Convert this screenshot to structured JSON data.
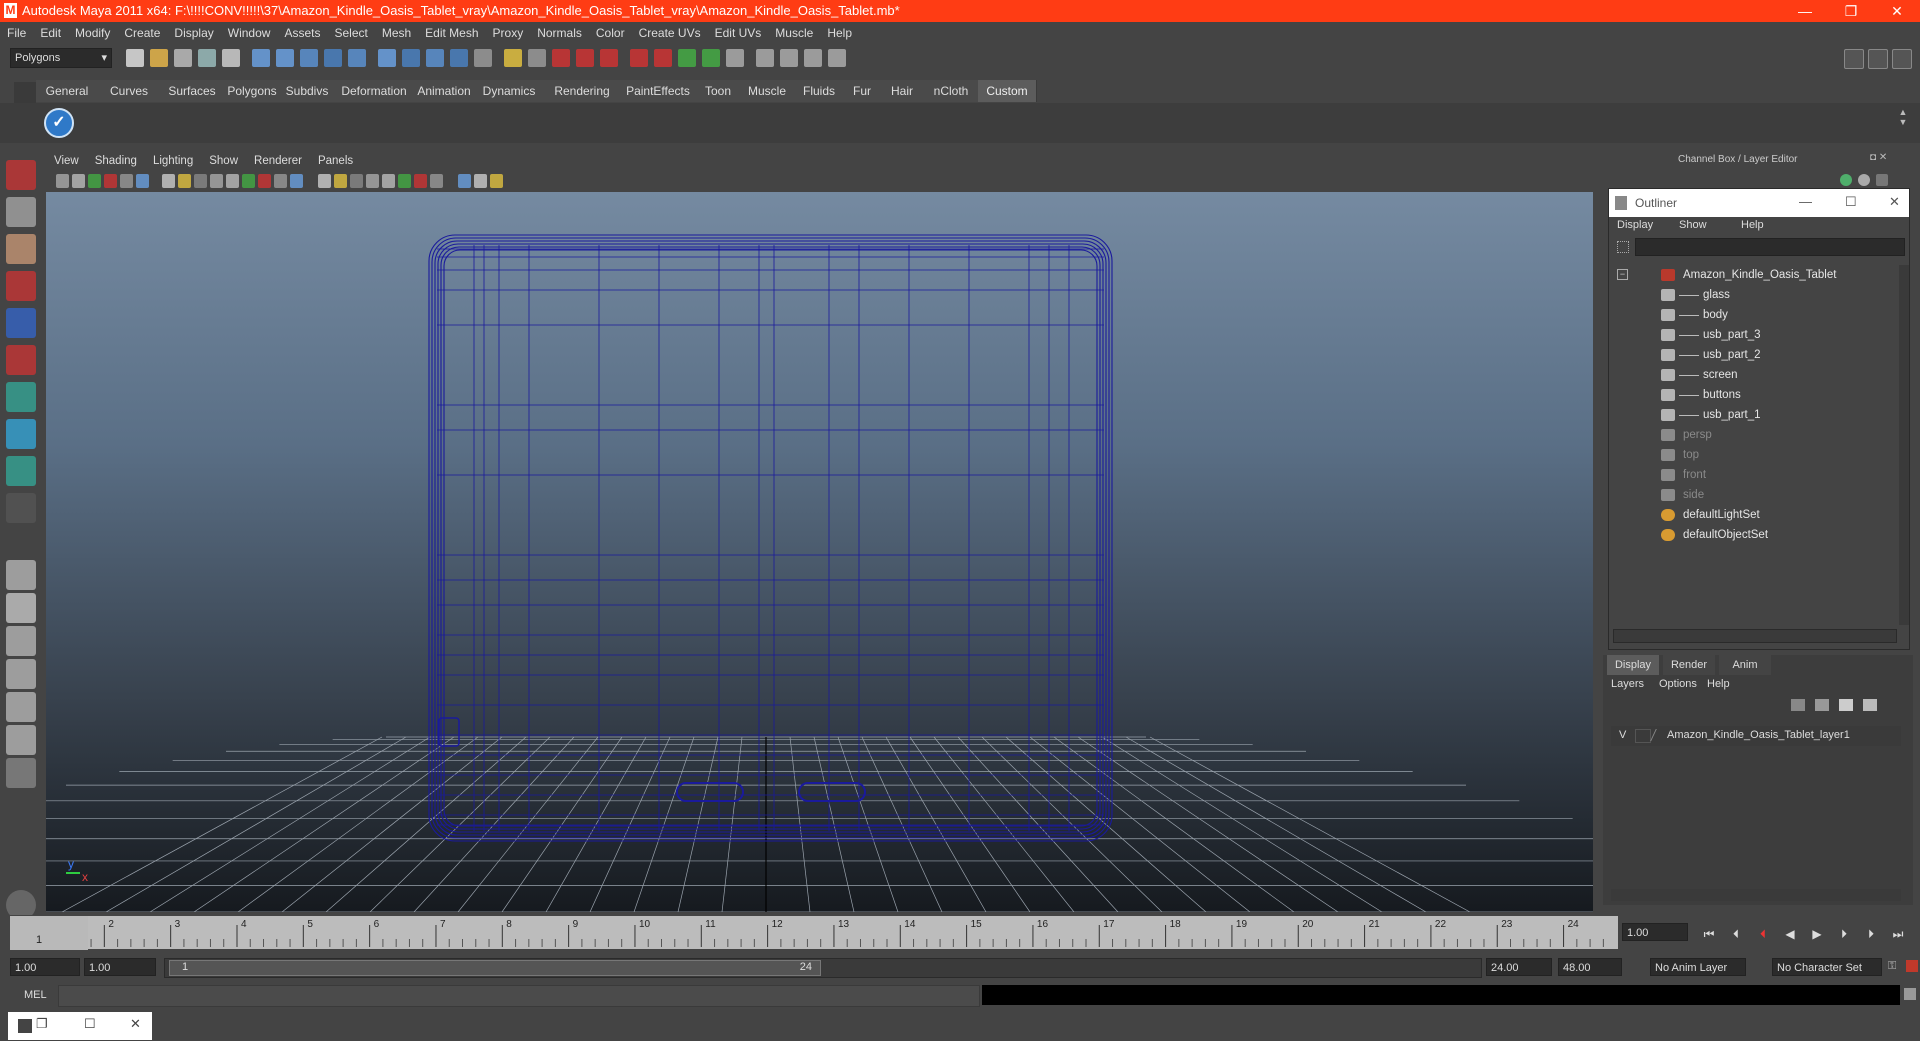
{
  "window": {
    "title": "Autodesk Maya 2011 x64: F:\\!!!!CONV!!!!!\\37\\Amazon_Kindle_Oasis_Tablet_vray\\Amazon_Kindle_Oasis_Tablet_vray\\Amazon_Kindle_Oasis_Tablet.mb*",
    "app_icon": "M",
    "minimize": "—",
    "restore": "❐",
    "close": "✕"
  },
  "menubar": [
    "File",
    "Edit",
    "Modify",
    "Create",
    "Display",
    "Window",
    "Assets",
    "Select",
    "Mesh",
    "Edit Mesh",
    "Proxy",
    "Normals",
    "Color",
    "Create UVs",
    "Edit UVs",
    "Muscle",
    "Help"
  ],
  "statusline": {
    "mode": "Polygons"
  },
  "shelf_tabs": [
    "General",
    "Curves",
    "Surfaces",
    "Polygons",
    "Subdivs",
    "Deformation",
    "Animation",
    "Dynamics",
    "Rendering",
    "PaintEffects",
    "Toon",
    "Muscle",
    "Fluids",
    "Fur",
    "Hair",
    "nCloth",
    "Custom"
  ],
  "shelf_active_tab": "Custom",
  "viewport": {
    "menu": [
      "View",
      "Shading",
      "Lighting",
      "Show",
      "Renderer",
      "Panels"
    ],
    "axis_y": "y",
    "axis_x": "x"
  },
  "channel_box": {
    "title": "Channel Box / Layer Editor"
  },
  "outliner": {
    "title": "Outliner",
    "menu": [
      "Display",
      "Show",
      "Help"
    ],
    "items": [
      {
        "label": "Amazon_Kindle_Oasis_Tablet",
        "level": 0,
        "dim": false,
        "kind": "group"
      },
      {
        "label": "glass",
        "level": 1,
        "dim": false,
        "kind": "mesh"
      },
      {
        "label": "body",
        "level": 1,
        "dim": false,
        "kind": "mesh"
      },
      {
        "label": "usb_part_3",
        "level": 1,
        "dim": false,
        "kind": "mesh"
      },
      {
        "label": "usb_part_2",
        "level": 1,
        "dim": false,
        "kind": "mesh"
      },
      {
        "label": "screen",
        "level": 1,
        "dim": false,
        "kind": "mesh"
      },
      {
        "label": "buttons",
        "level": 1,
        "dim": false,
        "kind": "mesh"
      },
      {
        "label": "usb_part_1",
        "level": 1,
        "dim": false,
        "kind": "mesh"
      },
      {
        "label": "persp",
        "level": 0,
        "dim": true,
        "kind": "camera"
      },
      {
        "label": "top",
        "level": 0,
        "dim": true,
        "kind": "camera"
      },
      {
        "label": "front",
        "level": 0,
        "dim": true,
        "kind": "camera"
      },
      {
        "label": "side",
        "level": 0,
        "dim": true,
        "kind": "camera"
      },
      {
        "label": "defaultLightSet",
        "level": 0,
        "dim": false,
        "kind": "set"
      },
      {
        "label": "defaultObjectSet",
        "level": 0,
        "dim": false,
        "kind": "set"
      }
    ]
  },
  "layer_editor": {
    "tabs": [
      "Display",
      "Render",
      "Anim"
    ],
    "active_tab": "Display",
    "menu": [
      "Layers",
      "Options",
      "Help"
    ],
    "layer": {
      "visible": "V",
      "name": "Amazon_Kindle_Oasis_Tablet_layer1"
    }
  },
  "timeline": {
    "ticks": [
      "1",
      "2",
      "3",
      "4",
      "5",
      "6",
      "7",
      "8",
      "9",
      "10",
      "11",
      "12",
      "13",
      "14",
      "15",
      "16",
      "17",
      "18",
      "19",
      "20",
      "21",
      "22",
      "23",
      "24"
    ],
    "current_frame_marker": "1",
    "current_time": "1.00"
  },
  "range": {
    "start": "1.00",
    "playback_start": "1.00",
    "slider_start": "1",
    "slider_end": "24",
    "playback_end": "24.00",
    "end": "48.00",
    "anim_layer": "No Anim Layer",
    "character_set": "No Character Set"
  },
  "cmdline": {
    "label": "MEL"
  },
  "colors": {
    "titlebar": "#ff3c14",
    "wireframe": "#1a1a9c",
    "grid": "#9aa3ad",
    "active_tab": "#5c5c5c"
  }
}
